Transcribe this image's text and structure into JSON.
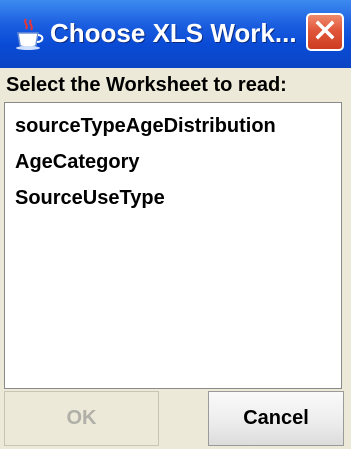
{
  "window": {
    "title": "Choose XLS Work...",
    "app_icon": "java-coffee-cup-icon",
    "close_icon": "close-icon"
  },
  "dialog": {
    "prompt": "Select the Worksheet to read:",
    "worksheets": [
      "sourceTypeAgeDistribution",
      "AgeCategory",
      "SourceUseType"
    ]
  },
  "buttons": {
    "ok_label": "OK",
    "ok_enabled": false,
    "cancel_label": "Cancel"
  },
  "colors": {
    "titlebar": "#0a4bd6",
    "close_button": "#e0573a",
    "dialog_bg": "#ece9d8",
    "disabled_text": "#b0b0a8"
  }
}
